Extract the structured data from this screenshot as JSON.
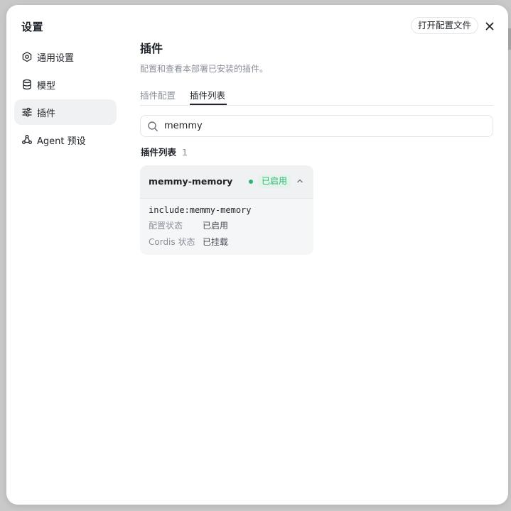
{
  "modal": {
    "title": "设置",
    "open_config_label": "打开配置文件"
  },
  "sidebar": {
    "items": [
      {
        "label": "通用设置",
        "icon": "gear-icon"
      },
      {
        "label": "模型",
        "icon": "database-icon"
      },
      {
        "label": "插件",
        "icon": "sliders-icon",
        "active": true
      },
      {
        "label": "Agent 预设",
        "icon": "agent-icon"
      }
    ]
  },
  "main": {
    "title": "插件",
    "description": "配置和查看本部署已安装的插件。",
    "tabs": [
      {
        "label": "插件配置",
        "active": false
      },
      {
        "label": "插件列表",
        "active": true
      }
    ],
    "search": {
      "value": "memmy",
      "icon": "search-icon"
    },
    "list": {
      "header": "插件列表",
      "count": "1"
    },
    "plugin": {
      "name": "memmy-memory",
      "status": "已启用",
      "status_color": "#2bb673",
      "include": "include:memmy-memory",
      "details": [
        {
          "key": "配置状态",
          "value": "已启用"
        },
        {
          "key": "Cordis 状态",
          "value": "已挂载"
        }
      ]
    }
  }
}
